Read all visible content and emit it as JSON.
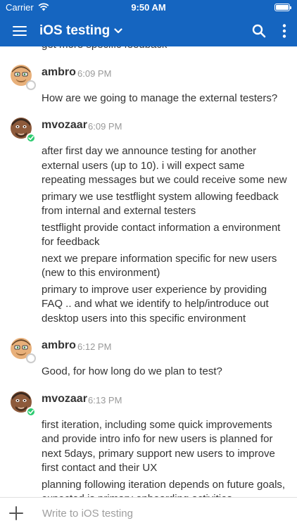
{
  "status_bar": {
    "carrier": "Carrier",
    "time": "9:50 AM"
  },
  "header": {
    "title": "iOS testing",
    "icons": [
      "hamburger-icon",
      "chevron-down-icon",
      "search-icon",
      "more-icon"
    ]
  },
  "messages": {
    "partial_top": "get more specific feedback",
    "groups": [
      {
        "sender": "ambro",
        "time": "6:09 PM",
        "presence": "away",
        "lines": [
          "How are we going to manage the external testers?"
        ]
      },
      {
        "sender": "mvozaar",
        "time": "6:09 PM",
        "presence": "online",
        "lines": [
          "after first day we announce testing for another external users (up to 10). i will expect same repeating messages but we could receive some new",
          "primary we use testflight system allowing feedback from internal and external testers",
          "testflight provide contact information a environment for feedback",
          "next we prepare information specific for new users (new to this environment)",
          "primary to improve user experience by providing FAQ .. and what we identify to help/introduce out desktop users into this specific environment"
        ]
      },
      {
        "sender": "ambro",
        "time": "6:12 PM",
        "presence": "away",
        "lines": [
          "Good, for how long do we plan to test?"
        ]
      },
      {
        "sender": "mvozaar",
        "time": "6:13 PM",
        "presence": "online",
        "lines": [
          "first iteration, including some quick improvements and provide intro info for new users is planned for next 5days, primary support new users to improve first contact and their UX",
          "planning following iteration depends on future goals, expected is primary onboarding activities"
        ]
      }
    ]
  },
  "composer": {
    "placeholder": "Write to iOS testing"
  },
  "colors": {
    "header_bg": "#1565c0",
    "text": "#333333",
    "timestamp": "#999999",
    "online": "#2ecc71"
  }
}
